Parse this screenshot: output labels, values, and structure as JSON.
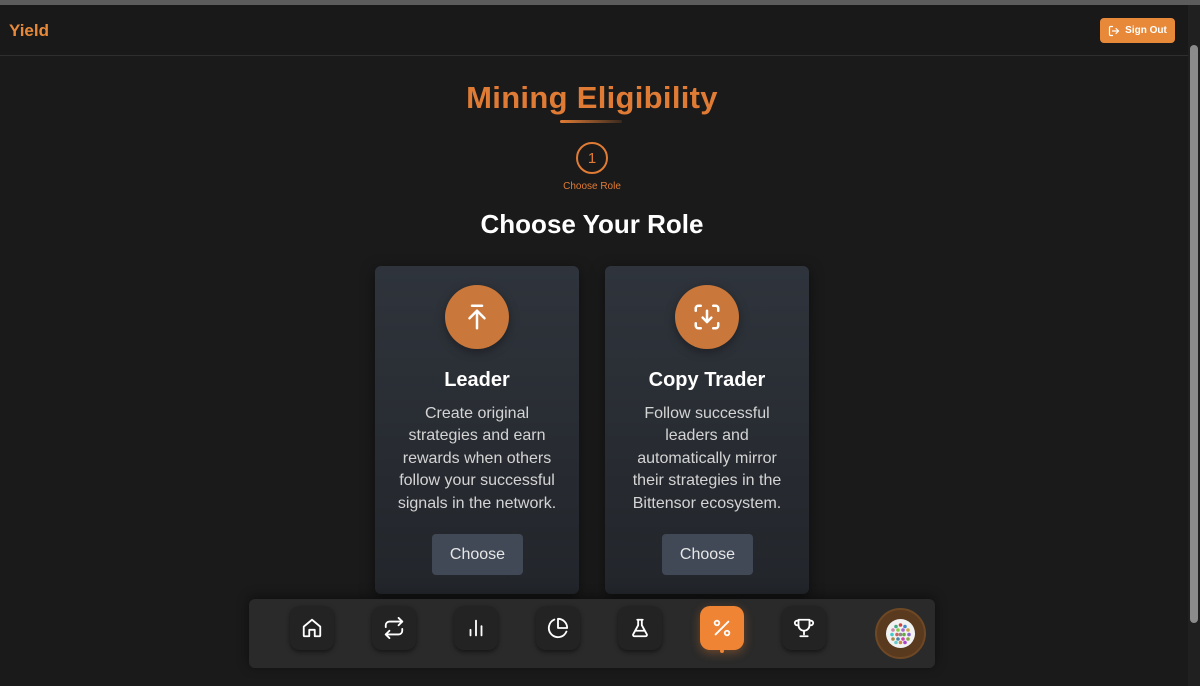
{
  "header": {
    "brand": "Yield",
    "signout_label": "Sign Out",
    "signout_icon": "logout-icon"
  },
  "page": {
    "title": "Mining Eligibility",
    "step": {
      "number": "1",
      "label": "Choose Role"
    },
    "subtitle": "Choose Your Role"
  },
  "roles": [
    {
      "title": "Leader",
      "description": "Create original strategies and earn rewards when others follow your successful signals in the network.",
      "button": "Choose",
      "icon": "arrow-up-to-line-icon"
    },
    {
      "title": "Copy Trader",
      "description": "Follow successful leaders and automatically mirror their strategies in the Bittensor ecosystem.",
      "button": "Choose",
      "icon": "scan-download-icon"
    }
  ],
  "dock": {
    "items": [
      {
        "icon": "home-icon",
        "active": false
      },
      {
        "icon": "repeat-icon",
        "active": false
      },
      {
        "icon": "bar-chart-icon",
        "active": false
      },
      {
        "icon": "pie-chart-icon",
        "active": false
      },
      {
        "icon": "flask-icon",
        "active": false
      },
      {
        "icon": "percent-icon",
        "active": true
      },
      {
        "icon": "trophy-icon",
        "active": false
      }
    ],
    "avatar": "avatar"
  },
  "colors": {
    "accent": "#e8893a",
    "background": "#1a1a1a",
    "card": "#2f343c",
    "button": "#414957"
  }
}
